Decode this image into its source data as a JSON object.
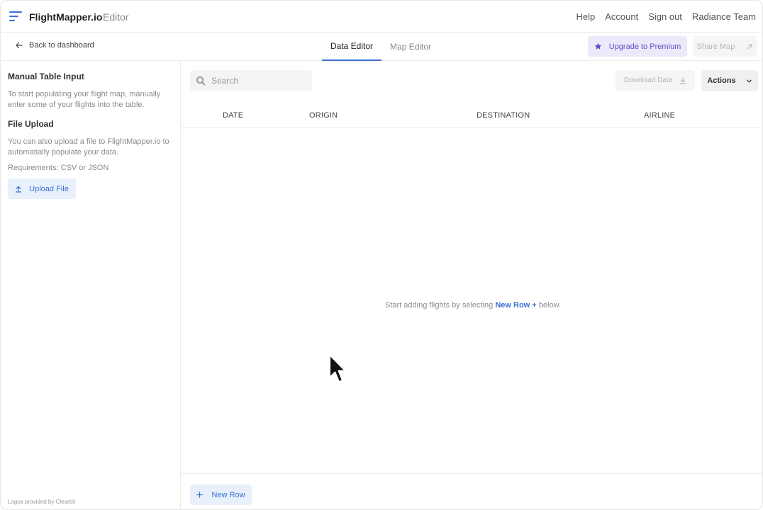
{
  "header": {
    "brand": "FlightMapper.io",
    "brand_sub": "Editor",
    "links": [
      "Help",
      "Account",
      "Sign out",
      "Radiance Team"
    ]
  },
  "subnav": {
    "back_label": "Back to dashboard",
    "tabs": [
      {
        "label": "Data Editor",
        "active": true
      },
      {
        "label": "Map Editor",
        "active": false
      }
    ],
    "upgrade_label": "Upgrade to Premium",
    "share_label": "Share Map"
  },
  "sidebar": {
    "manual_heading": "Manual Table Input",
    "manual_text": "To start populating your flight map, manually enter some of your flights into the table.",
    "file_heading": "File Upload",
    "file_text": "You can also upload a file to FlightMapper.io to automatially populate your data.",
    "requirements": "Requirements: CSV or JSON",
    "upload_label": "Upload File",
    "footer": "Logos provided by Clearbit"
  },
  "main": {
    "search_placeholder": "Search",
    "download_label": "Download Data",
    "actions_label": "Actions",
    "columns": [
      "DATE",
      "ORIGIN",
      "DESTINATION",
      "AIRLINE"
    ],
    "empty_prefix": "Start adding flights by selecting",
    "empty_link": "New Row +",
    "empty_suffix": "below.",
    "new_row_label": "New Row"
  },
  "colors": {
    "accent": "#3b6fd4",
    "premium": "#5b4fc7"
  }
}
